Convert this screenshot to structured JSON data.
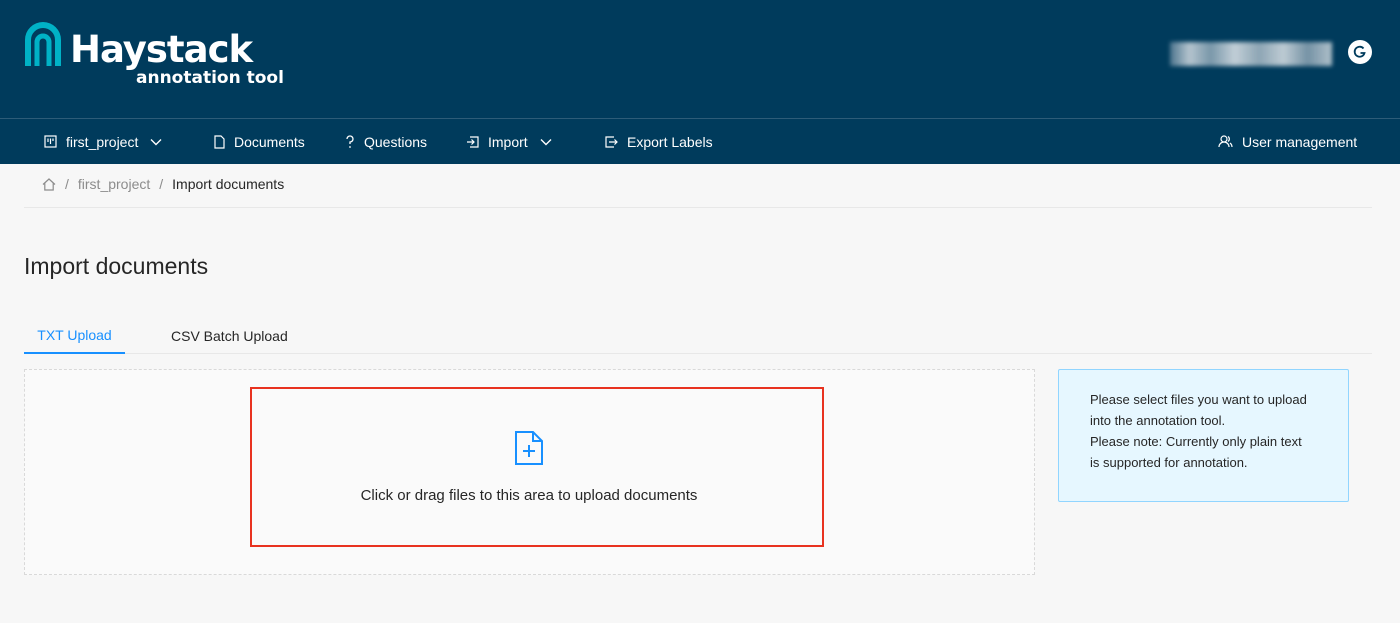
{
  "brand": {
    "title": "Haystack",
    "subtitle": "annotation tool",
    "accent": "#00b2c6",
    "header_bg": "#003b5c"
  },
  "nav": {
    "project": {
      "label": "first_project",
      "icon": "project-icon"
    },
    "documents": {
      "label": "Documents",
      "icon": "document-icon"
    },
    "questions": {
      "label": "Questions",
      "icon": "question-icon"
    },
    "import": {
      "label": "Import",
      "icon": "import-icon"
    },
    "export": {
      "label": "Export Labels",
      "icon": "export-icon"
    },
    "users": {
      "label": "User management",
      "icon": "users-icon"
    }
  },
  "breadcrumb": {
    "project": "first_project",
    "current": "Import documents",
    "separator": "/"
  },
  "page": {
    "title": "Import documents"
  },
  "tabs": [
    {
      "label": "TXT Upload",
      "active": true
    },
    {
      "label": "CSV Batch Upload",
      "active": false
    }
  ],
  "upload": {
    "prompt": "Click or drag files to this area to upload documents",
    "icon": "file-add-icon",
    "icon_color": "#1890ff",
    "highlight_color": "#e8321f"
  },
  "info": {
    "lines": [
      "Please select files you want to upload",
      "into the annotation tool.",
      "Please note: Currently only plain text",
      "is supported for annotation."
    ]
  }
}
